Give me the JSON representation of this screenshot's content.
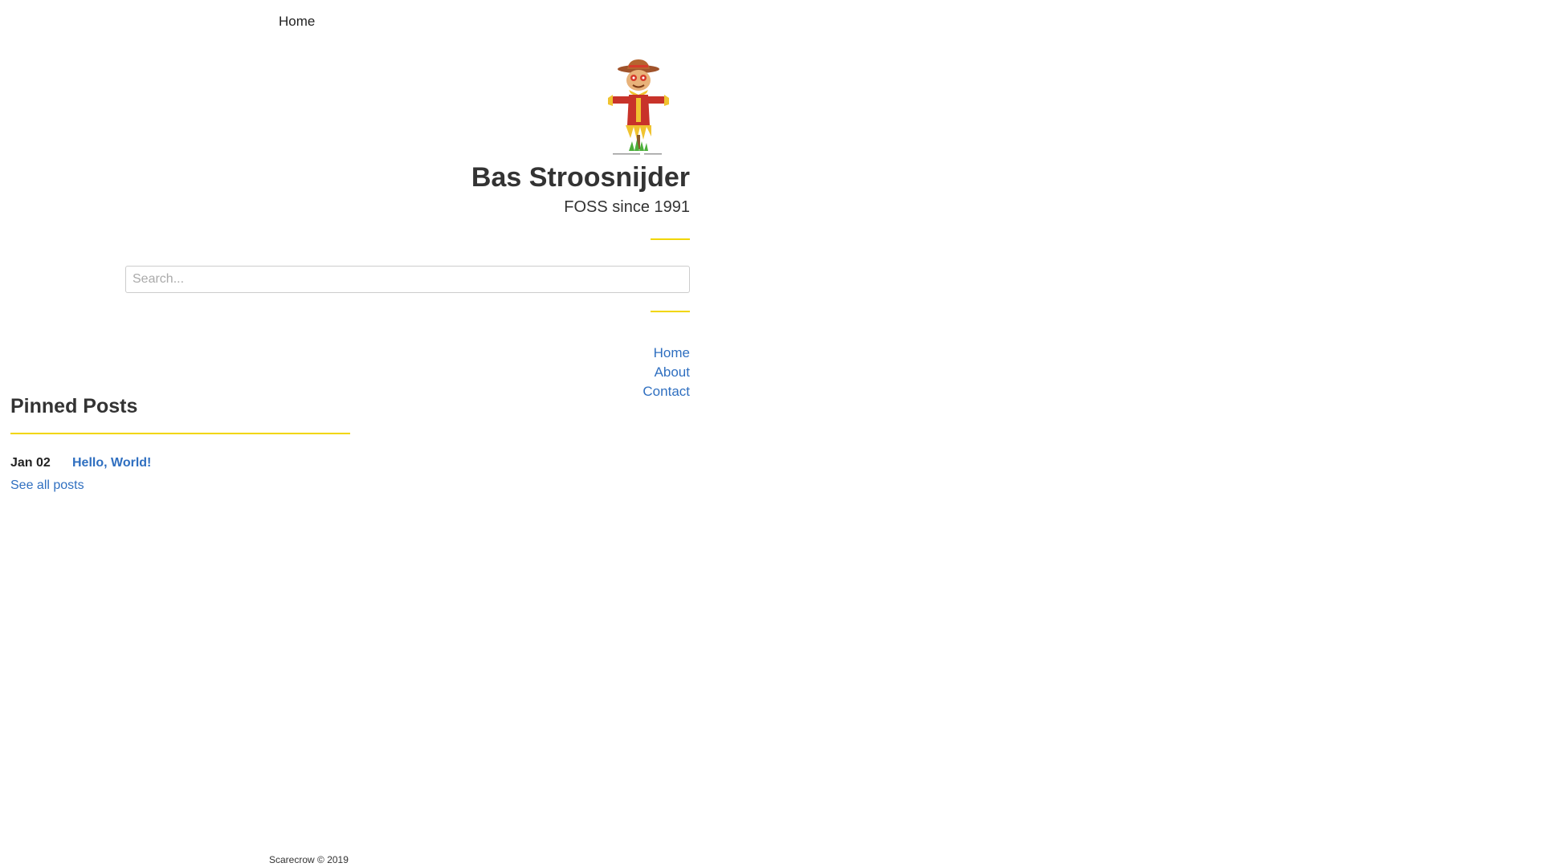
{
  "top_nav": {
    "home_label": "Home"
  },
  "site": {
    "title": "Bas Stroosnijder",
    "tagline": "FOSS since 1991",
    "logo_icon": "scarecrow-icon"
  },
  "search": {
    "placeholder": "Search...",
    "value": ""
  },
  "menu": {
    "items": [
      {
        "label": "Home"
      },
      {
        "label": "About"
      },
      {
        "label": "Contact"
      }
    ]
  },
  "pinned": {
    "title": "Pinned Posts",
    "posts": [
      {
        "date": "Jan 02",
        "title": "Hello, World!"
      }
    ],
    "see_all_label": "See all posts"
  },
  "footer": {
    "text": "Scarecrow © 2019"
  },
  "colors": {
    "accent": "#f1d600",
    "link": "#2f6fc0",
    "text": "#333333"
  }
}
